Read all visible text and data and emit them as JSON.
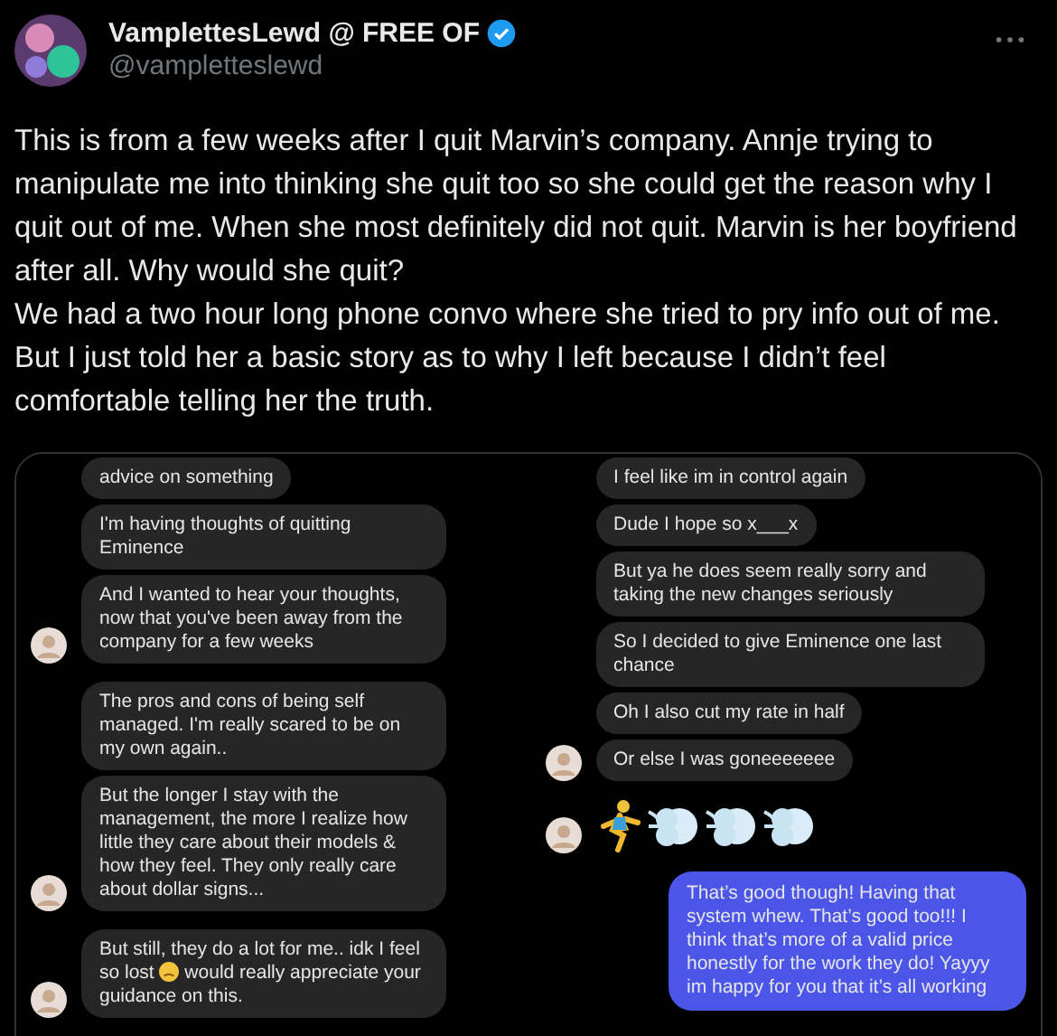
{
  "post": {
    "display_name": "VamplettesLewd @ FREE OF",
    "verified": true,
    "handle": "@vampletteslewd",
    "body": "This is from a few weeks after I quit Marvin’s company. Annje trying to manipulate me into thinking she quit too so she could get the reason why I quit out of me. When she most definitely did not quit. Marvin is her boyfriend after all. Why would she quit?\nWe had a two hour long phone convo where she tried to pry info out of me. But I just told her a basic story as to why I left because I didn’t feel comfortable telling her the truth."
  },
  "chat_screenshots": [
    {
      "messages": [
        {
          "kind": "text",
          "outgoing": false,
          "avatar": false,
          "text": "advice on something"
        },
        {
          "kind": "text",
          "outgoing": false,
          "avatar": false,
          "text": "I'm having thoughts of quitting Eminence"
        },
        {
          "kind": "text",
          "outgoing": false,
          "avatar": true,
          "text": "And I wanted to hear your thoughts, now that you've been away from the company for a few weeks"
        },
        {
          "kind": "text",
          "outgoing": false,
          "avatar": false,
          "text": "The pros and cons of being self managed. I'm really scared to be on my own again.."
        },
        {
          "kind": "text",
          "outgoing": false,
          "avatar": true,
          "text": "But the longer I stay with the management, the more I realize how little they care about their models & how they feel. They only really care about dollar signs..."
        },
        {
          "kind": "text_emoji",
          "outgoing": false,
          "avatar": true,
          "text_before": "But still, they do a lot for me.. idk I feel so lost",
          "text_after": "would really appreciate your guidance on this."
        }
      ]
    },
    {
      "messages": [
        {
          "kind": "text",
          "outgoing": false,
          "avatar": false,
          "text": "I feel like im in control again"
        },
        {
          "kind": "text",
          "outgoing": false,
          "avatar": false,
          "text": "Dude I hope so x___x"
        },
        {
          "kind": "text",
          "outgoing": false,
          "avatar": false,
          "text": "But ya he does seem really sorry and taking the new changes seriously"
        },
        {
          "kind": "text",
          "outgoing": false,
          "avatar": false,
          "text": "So I decided to give Eminence one last chance"
        },
        {
          "kind": "text",
          "outgoing": false,
          "avatar": false,
          "text": "Oh I also cut my rate in half"
        },
        {
          "kind": "text",
          "outgoing": false,
          "avatar": true,
          "text": "Or else I was goneeeeeee"
        },
        {
          "kind": "emoji",
          "outgoing": false,
          "avatar": true
        },
        {
          "kind": "text",
          "outgoing": true,
          "avatar": false,
          "text": "That’s good though! Having that system whew. That’s good too!!! I think that’s more of a valid price honestly for the work they do! Yayyy im happy for you that it’s all working"
        }
      ]
    }
  ]
}
